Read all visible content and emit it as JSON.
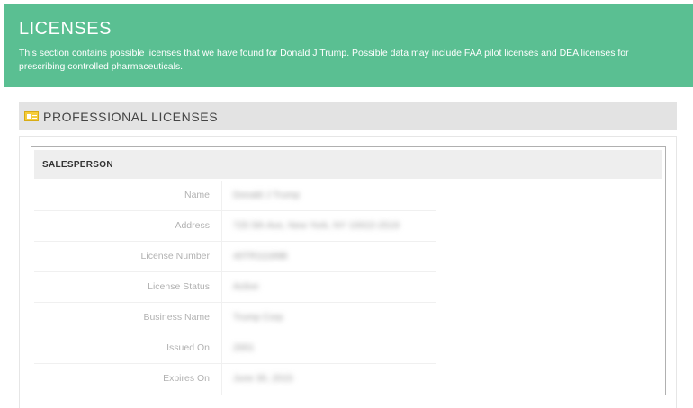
{
  "header": {
    "title": "LICENSES",
    "description": "This section contains possible licenses that we have found for Donald J Trump. Possible data may include FAA pilot licenses and DEA licenses for prescribing controlled pharmaceuticals.",
    "background_color": "#5abf92"
  },
  "section": {
    "icon": "id-card-icon",
    "title": "PROFESSIONAL LICENSES"
  },
  "license_card": {
    "title": "SALESPERSON",
    "rows": [
      {
        "label": "Name",
        "value": "Donald J Trump"
      },
      {
        "label": "Address",
        "value": "725 5th Ave, New York, NY 10022-2519"
      },
      {
        "label": "License Number",
        "value": "40TR11189B"
      },
      {
        "label": "License Status",
        "value": "Active"
      },
      {
        "label": "Business Name",
        "value": "Trump Corp"
      },
      {
        "label": "Issued On",
        "value": "2001"
      },
      {
        "label": "Expires On",
        "value": "June 30, 2015"
      }
    ]
  }
}
